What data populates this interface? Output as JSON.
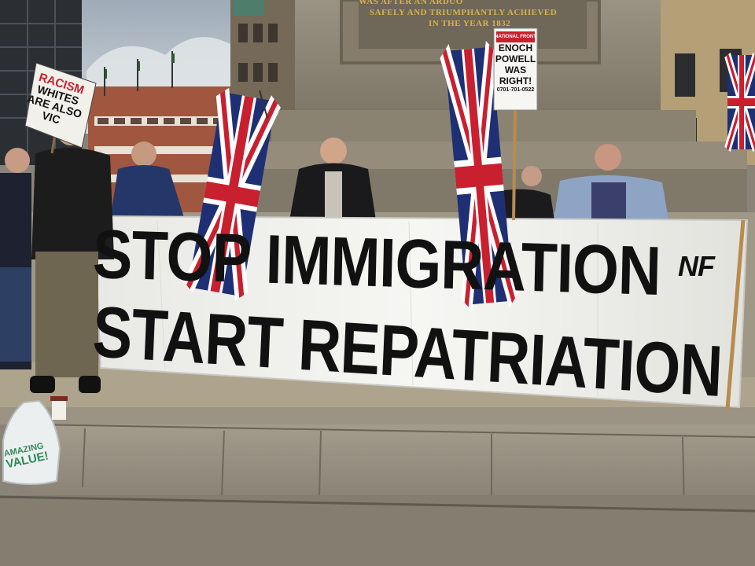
{
  "scene": {
    "description_tag": "street-protest-photo"
  },
  "monument_inscription": {
    "line1": "WAS AFTER AN ARDUO",
    "line2": "SAFELY AND TRIUMPHANTLY ACHIEVED",
    "line3": "IN THE YEAR 1832"
  },
  "banner": {
    "line1": "STOP IMMIGRATION",
    "line2": "START REPATRIATION",
    "logo": "NF"
  },
  "left_placard": {
    "line1": "RACISM",
    "line2": "WHITES",
    "line3": "ARE ALSO",
    "line4": "VIC"
  },
  "right_placard": {
    "header": "NATIONAL FRONT",
    "line1": "ENOCH",
    "line2": "POWELL",
    "line3": "WAS",
    "line4": "RIGHT!",
    "phone": "0701-701-0522"
  },
  "shopping_bag": {
    "line1": "AMAZING",
    "line2": "VALUE!"
  },
  "colors": {
    "sky": "#b7c3cc",
    "stone": "#8e8676",
    "banner_bg": "#f1f1ee",
    "banner_ink": "#111111",
    "flag_blue": "#1f2f74",
    "flag_red": "#c8202f",
    "inscription_gold": "#d9b24a",
    "brick": "#a0563f"
  }
}
